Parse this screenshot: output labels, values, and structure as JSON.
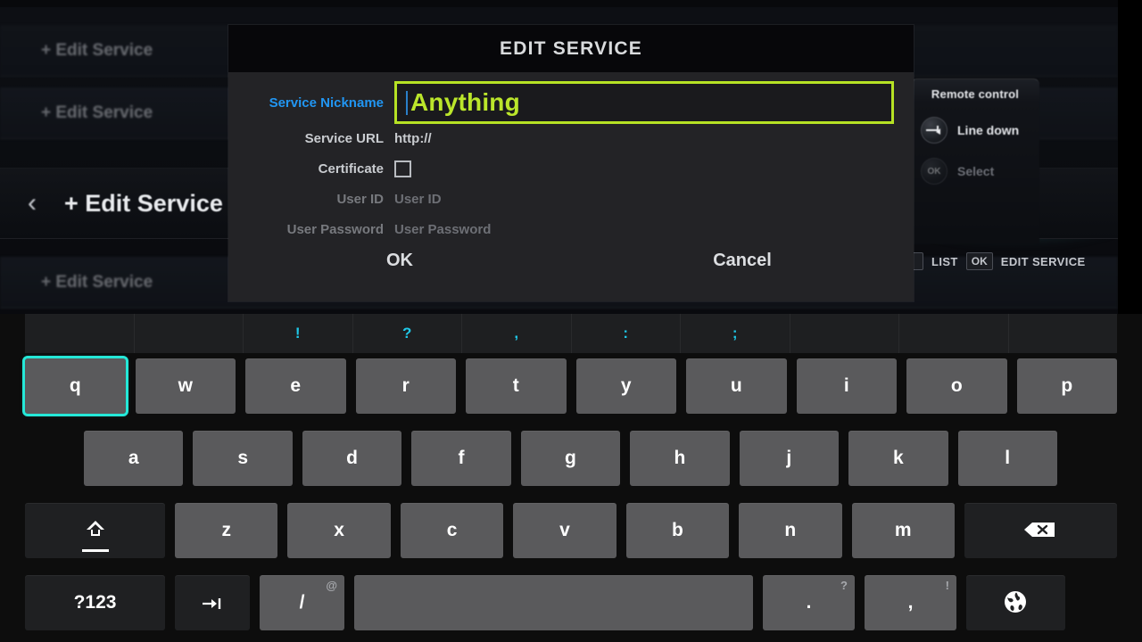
{
  "background": {
    "rows": [
      {
        "label": "+ Edit Service"
      },
      {
        "label": "+ Edit Service"
      },
      {
        "label": "+ Edit Service"
      }
    ],
    "selected_row": {
      "back_icon": "chevron-left-icon",
      "label": "+ Edit Service"
    },
    "behind_keyboard": {
      "left_label": "Service Nickname",
      "right_label": "+ Edit Service"
    }
  },
  "remote_control": {
    "title": "Remote control",
    "items": [
      {
        "icon": "line-down-icon",
        "key": "",
        "label": "Line down",
        "enabled": true
      },
      {
        "icon": "ok-icon",
        "key": "OK",
        "label": "Select",
        "enabled": false
      }
    ]
  },
  "hint_bar": {
    "back_key": "‹",
    "back_label": "LIST",
    "ok_key": "OK",
    "ok_label": "EDIT SERVICE"
  },
  "dialog": {
    "title": "EDIT SERVICE",
    "fields": {
      "nickname": {
        "label": "Service Nickname",
        "value": "Anything",
        "placeholder": "Service Nickname"
      },
      "url": {
        "label": "Service URL",
        "value": "http://"
      },
      "certificate": {
        "label": "Certificate",
        "checked": false
      },
      "user_id": {
        "label": "User ID",
        "value": "",
        "placeholder": "User ID"
      },
      "user_password": {
        "label": "User Password",
        "value": "",
        "placeholder": "User Password"
      }
    },
    "buttons": {
      "ok": "OK",
      "cancel": "Cancel"
    }
  },
  "keyboard": {
    "symbol_row": [
      "",
      "",
      "!",
      "?",
      ",",
      ":",
      ";",
      "",
      "",
      ""
    ],
    "row1": [
      "q",
      "w",
      "e",
      "r",
      "t",
      "y",
      "u",
      "i",
      "o",
      "p"
    ],
    "row2": [
      "a",
      "s",
      "d",
      "f",
      "g",
      "h",
      "j",
      "k",
      "l"
    ],
    "row3": [
      "z",
      "x",
      "c",
      "v",
      "b",
      "n",
      "m"
    ],
    "focused_key": "q",
    "special": {
      "shift": "shift-icon",
      "backspace": "backspace-icon",
      "numbers": "?123",
      "tab": "tab-icon",
      "slash": "/",
      "slash_sup": "@",
      "space": "",
      "period": ".",
      "period_sup": "?",
      "comma": ",",
      "comma_sup": "!",
      "globe": "globe-icon"
    }
  },
  "colors": {
    "accent_green": "#bbe62b",
    "focus_cyan": "#25e8d8",
    "label_blue": "#2196f3",
    "symbol_cyan": "#1fc8e8"
  }
}
